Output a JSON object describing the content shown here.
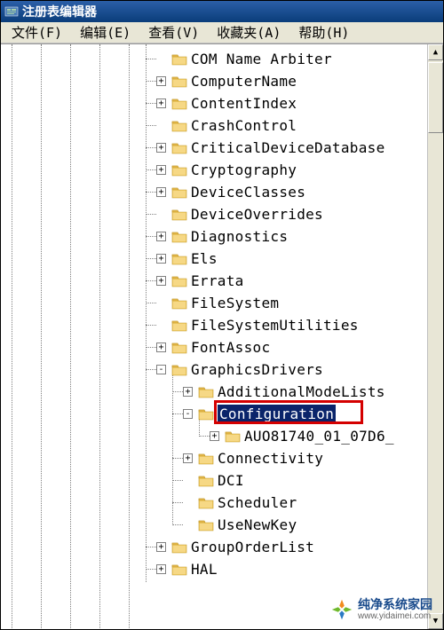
{
  "window": {
    "title": "注册表编辑器"
  },
  "menu": {
    "file": "文件(F)",
    "edit": "编辑(E)",
    "view": "查看(V)",
    "favorites": "收藏夹(A)",
    "help": "帮助(H)"
  },
  "tree": [
    {
      "indent": 0,
      "expander": "null",
      "label": "COM Name Arbiter"
    },
    {
      "indent": 0,
      "expander": "+",
      "label": "ComputerName"
    },
    {
      "indent": 0,
      "expander": "+",
      "label": "ContentIndex"
    },
    {
      "indent": 0,
      "expander": "null",
      "label": "CrashControl"
    },
    {
      "indent": 0,
      "expander": "+",
      "label": "CriticalDeviceDatabase"
    },
    {
      "indent": 0,
      "expander": "+",
      "label": "Cryptography"
    },
    {
      "indent": 0,
      "expander": "+",
      "label": "DeviceClasses"
    },
    {
      "indent": 0,
      "expander": "null",
      "label": "DeviceOverrides"
    },
    {
      "indent": 0,
      "expander": "+",
      "label": "Diagnostics"
    },
    {
      "indent": 0,
      "expander": "+",
      "label": "Els"
    },
    {
      "indent": 0,
      "expander": "+",
      "label": "Errata"
    },
    {
      "indent": 0,
      "expander": "null",
      "label": "FileSystem"
    },
    {
      "indent": 0,
      "expander": "null",
      "label": "FileSystemUtilities"
    },
    {
      "indent": 0,
      "expander": "+",
      "label": "FontAssoc"
    },
    {
      "indent": 0,
      "expander": "-",
      "label": "GraphicsDrivers"
    },
    {
      "indent": 1,
      "expander": "+",
      "label": "AdditionalModeLists"
    },
    {
      "indent": 1,
      "expander": "-",
      "label": "Configuration",
      "selected": true,
      "highlight": true
    },
    {
      "indent": 2,
      "expander": "+",
      "label": "AUO81740_01_07D6_"
    },
    {
      "indent": 1,
      "expander": "+",
      "label": "Connectivity"
    },
    {
      "indent": 1,
      "expander": "null",
      "label": "DCI"
    },
    {
      "indent": 1,
      "expander": "null",
      "label": "Scheduler"
    },
    {
      "indent": 1,
      "expander": "null",
      "label": "UseNewKey"
    },
    {
      "indent": 0,
      "expander": "+",
      "label": "GroupOrderList"
    },
    {
      "indent": 0,
      "expander": "+",
      "label": "HAL"
    }
  ],
  "watermark": {
    "main": "纯净系统家园",
    "sub": "www.yidaimei.com"
  }
}
